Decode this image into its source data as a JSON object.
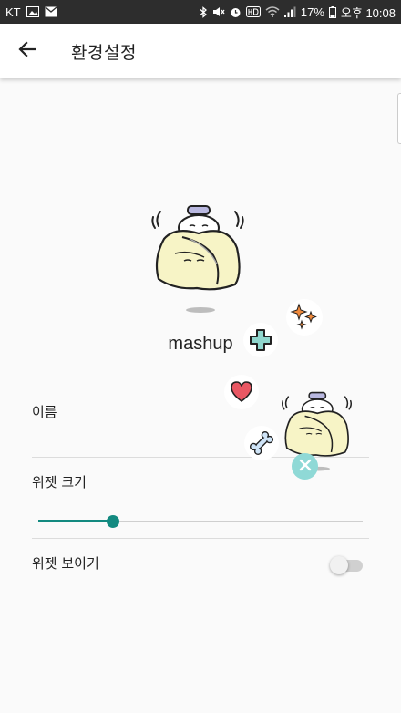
{
  "status_bar": {
    "carrier": "KT",
    "battery": "17%",
    "time": "오후 10:08"
  },
  "app_bar": {
    "title": "환경설정"
  },
  "avatar": {
    "name": "mashup"
  },
  "settings": {
    "name_label": "이름",
    "name_value": "",
    "size_label": "위젯 크기",
    "size_value": 0.23,
    "visible_label": "위젯 보이기",
    "visible_on": false
  },
  "colors": {
    "accent": "#138a80",
    "status_bar": "#2d2d2d",
    "heart": "#e85763",
    "cross": "#8fd6cd",
    "close_bubble": "#8fd9d6"
  },
  "floating_menu": {
    "items": [
      "sparkle-icon",
      "plus-icon",
      "heart-icon",
      "bone-icon",
      "close-icon"
    ]
  }
}
